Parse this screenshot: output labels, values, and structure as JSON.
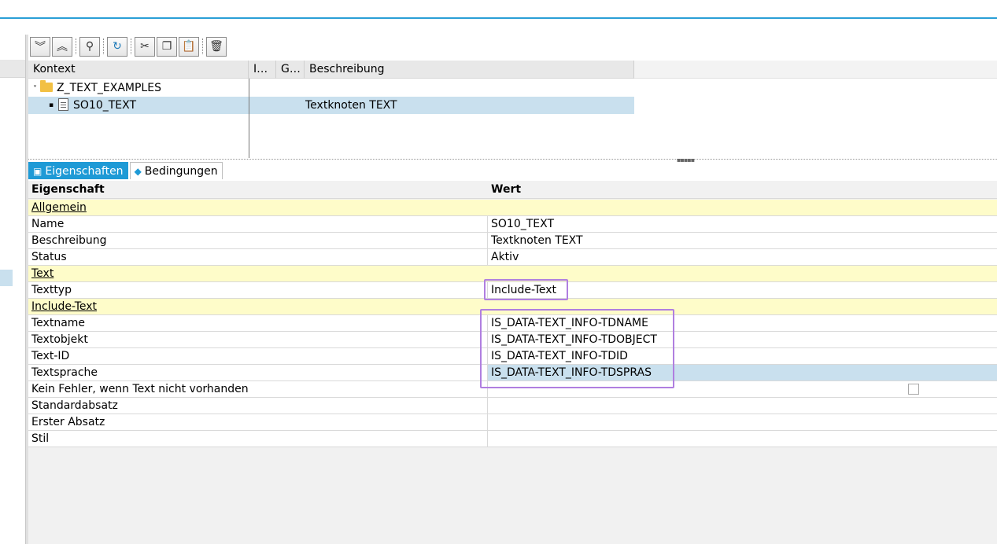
{
  "toolbar": {
    "buttons": [
      "expand-all",
      "collapse-all",
      "find",
      "refresh",
      "cut",
      "copy",
      "paste",
      "delete"
    ]
  },
  "tree": {
    "columns": [
      "Kontext",
      "I…",
      "G…",
      "Beschreibung"
    ],
    "rows": [
      {
        "name": "Z_TEXT_EXAMPLES",
        "description": ""
      },
      {
        "name": "SO10_TEXT",
        "description": "Textknoten TEXT"
      }
    ]
  },
  "tabs": [
    {
      "label": "Eigenschaften",
      "active": true
    },
    {
      "label": "Bedingungen",
      "active": false
    }
  ],
  "grid": {
    "col_property": "Eigenschaft",
    "col_value": "Wert",
    "rows": [
      {
        "property": "Allgemein",
        "value": "",
        "group": true
      },
      {
        "property": "Name",
        "value": "SO10_TEXT"
      },
      {
        "property": "Beschreibung",
        "value": "Textknoten TEXT"
      },
      {
        "property": "Status",
        "value": "Aktiv"
      },
      {
        "property": "Text",
        "value": "",
        "group": true
      },
      {
        "property": "Texttyp",
        "value": "Include-Text"
      },
      {
        "property": "Include-Text",
        "value": "",
        "group": true
      },
      {
        "property": "Textname",
        "value": "IS_DATA-TEXT_INFO-TDNAME"
      },
      {
        "property": "Textobjekt",
        "value": "IS_DATA-TEXT_INFO-TDOBJECT"
      },
      {
        "property": "Text-ID",
        "value": "IS_DATA-TEXT_INFO-TDID"
      },
      {
        "property": "Textsprache",
        "value": "IS_DATA-TEXT_INFO-TDSPRAS",
        "selected": true
      },
      {
        "property": "Kein Fehler, wenn Text nicht vorhanden",
        "value": "",
        "checkbox": false
      },
      {
        "property": "Standardabsatz",
        "value": ""
      },
      {
        "property": "Erster Absatz",
        "value": ""
      },
      {
        "property": "Stil",
        "value": ""
      }
    ]
  },
  "colors": {
    "accent": "#1e9ad6",
    "group_row": "#fefcc9",
    "selection": "#c9e0ee",
    "highlight_box": "#b07fe0"
  }
}
